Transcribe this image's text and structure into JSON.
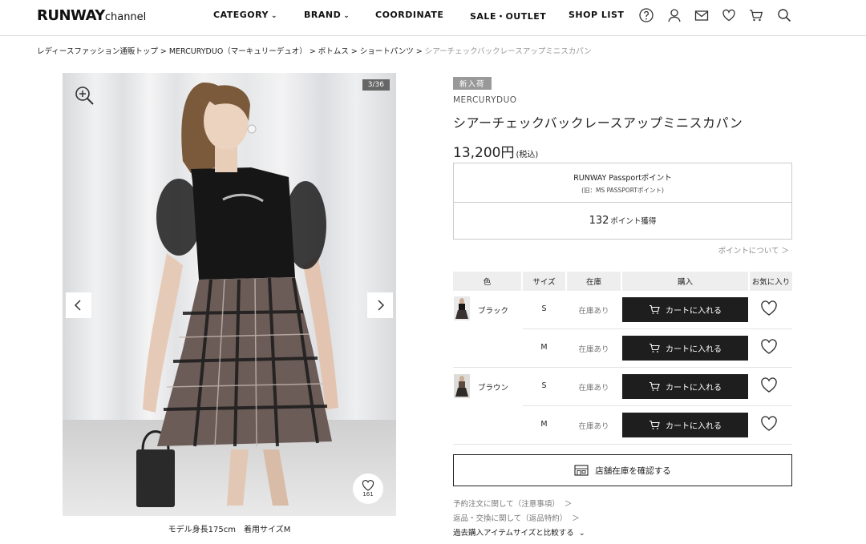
{
  "header": {
    "logo_main": "RUNWAY",
    "logo_sub": "channel",
    "nav": [
      {
        "label": "CATEGORY",
        "chevron": "⌄"
      },
      {
        "label": "BRAND",
        "chevron": "⌄"
      },
      {
        "label": "COORDINATE"
      },
      {
        "label": "SALE・OUTLET"
      },
      {
        "label": "SHOP LIST"
      }
    ],
    "icons": [
      "help-icon",
      "user-icon",
      "mail-icon",
      "heart-icon",
      "cart-icon",
      "search-icon"
    ]
  },
  "breadcrumb": {
    "items": [
      "レディースファッション通販トップ",
      "MERCURYDUO（マーキュリーデュオ）",
      "ボトムス",
      "ショートパンツ"
    ],
    "current": "シアーチェックバックレースアップミニスカパン",
    "separator": ">"
  },
  "gallery": {
    "counter": "3/36",
    "favorite_count": "161",
    "caption": "モデル身長175cm　着用サイズM"
  },
  "product": {
    "badge": "新入荷",
    "brand": "MERCURYDUO",
    "title": "シアーチェックバックレースアップミニスカパン",
    "price": "13,200円",
    "tax_note": "(税込)"
  },
  "points": {
    "title": "RUNWAY Passportポイント",
    "subtitle": "(旧：MS PASSPORTポイント)",
    "value": "132",
    "unit": "ポイント獲得",
    "about_link": "ポイントについて ＞"
  },
  "stock_table": {
    "headers": [
      "色",
      "サイズ",
      "在庫",
      "購入",
      "お気に入り"
    ],
    "cart_label": "カートに入れる",
    "rows": [
      {
        "color": "ブラック",
        "size": "S",
        "stock": "在庫あり"
      },
      {
        "size": "M",
        "stock": "在庫あり"
      },
      {
        "color": "ブラウン",
        "size": "S",
        "stock": "在庫あり"
      },
      {
        "size": "M",
        "stock": "在庫あり"
      }
    ]
  },
  "store_button": "店舗在庫を確認する",
  "footer_links": [
    {
      "label": "予約注文に関して（注意事項）",
      "chevron": "＞"
    },
    {
      "label": "返品・交換に関して（返品特約）",
      "chevron": "＞"
    },
    {
      "label": "過去購入アイテムサイズと比較する",
      "chevron": "⌄"
    }
  ],
  "colors": {
    "cart_button": "#1e1e1e",
    "badge": "#999999",
    "table_header": "#eeeeee"
  }
}
